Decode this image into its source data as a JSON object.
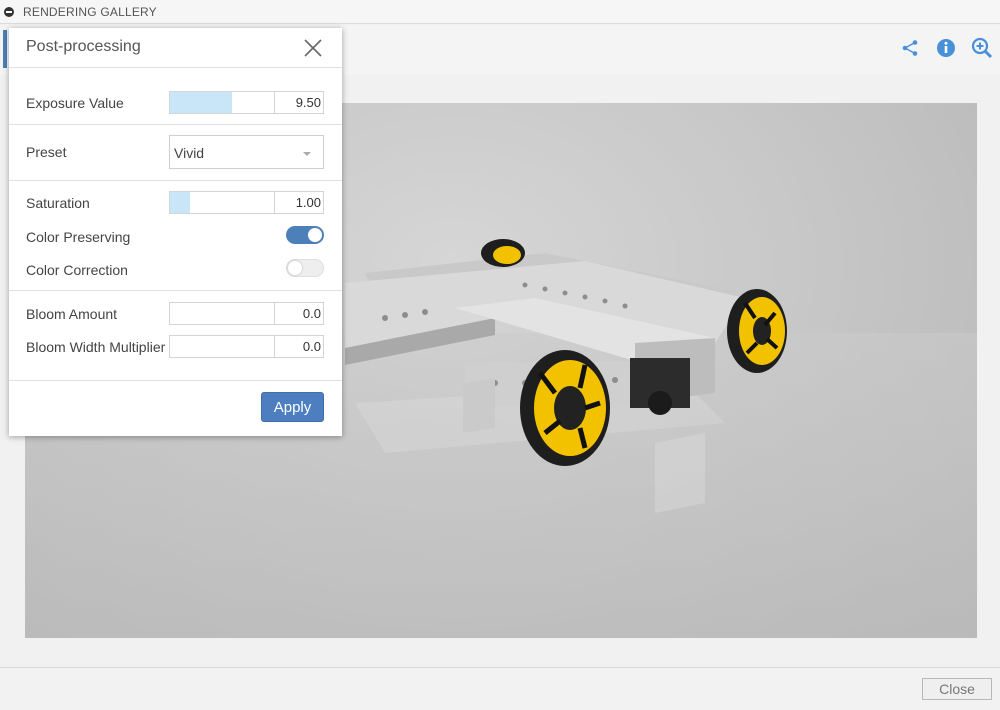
{
  "window": {
    "title": "RENDERING GALLERY"
  },
  "toolbar": {
    "icons": [
      "share-icon",
      "info-icon",
      "zoom-in-icon"
    ],
    "accent": "#4a90d9"
  },
  "panel": {
    "title": "Post-processing",
    "exposure": {
      "label": "Exposure Value",
      "value": "9.50",
      "fill": 0.6
    },
    "preset": {
      "label": "Preset",
      "value": "Vivid"
    },
    "saturation": {
      "label": "Saturation",
      "value": "1.00",
      "fill": 0.19
    },
    "color_preserving": {
      "label": "Color Preserving",
      "on": true
    },
    "color_correction": {
      "label": "Color Correction",
      "on": false
    },
    "bloom_amount": {
      "label": "Bloom Amount",
      "value": "0.0"
    },
    "bloom_width": {
      "label": "Bloom Width Multiplier",
      "value": "0.0"
    },
    "apply_label": "Apply"
  },
  "footer": {
    "close_label": "Close"
  },
  "colors": {
    "toggle_on": "#4d7fb9",
    "button": "#4d7fc0",
    "slider_fill": "#c8e6f8",
    "wheel_yellow": "#f2c200"
  }
}
